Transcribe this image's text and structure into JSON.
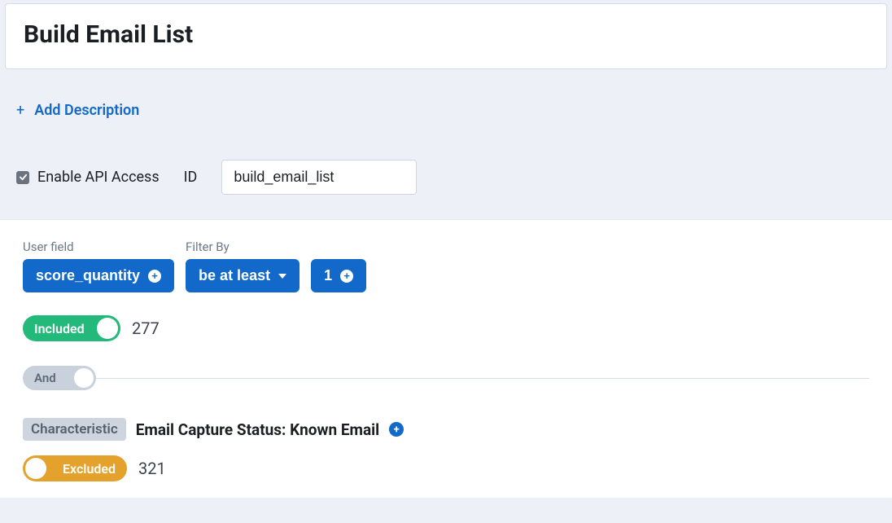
{
  "title": "Build Email List",
  "add_description": {
    "label": "Add Description"
  },
  "api": {
    "enable_label": "Enable API Access",
    "checked": true,
    "id_label": "ID",
    "id_value": "build_email_list"
  },
  "labels": {
    "user_field": "User field",
    "filter_by": "Filter By"
  },
  "filters": {
    "user_field_value": "score_quantity",
    "operator": "be at least",
    "value": "1"
  },
  "included": {
    "label": "Included",
    "count": "277"
  },
  "logic": {
    "and_label": "And"
  },
  "characteristic": {
    "tag": "Characteristic",
    "text": "Email Capture Status: Known Email"
  },
  "excluded": {
    "label": "Excluded",
    "count": "321"
  }
}
